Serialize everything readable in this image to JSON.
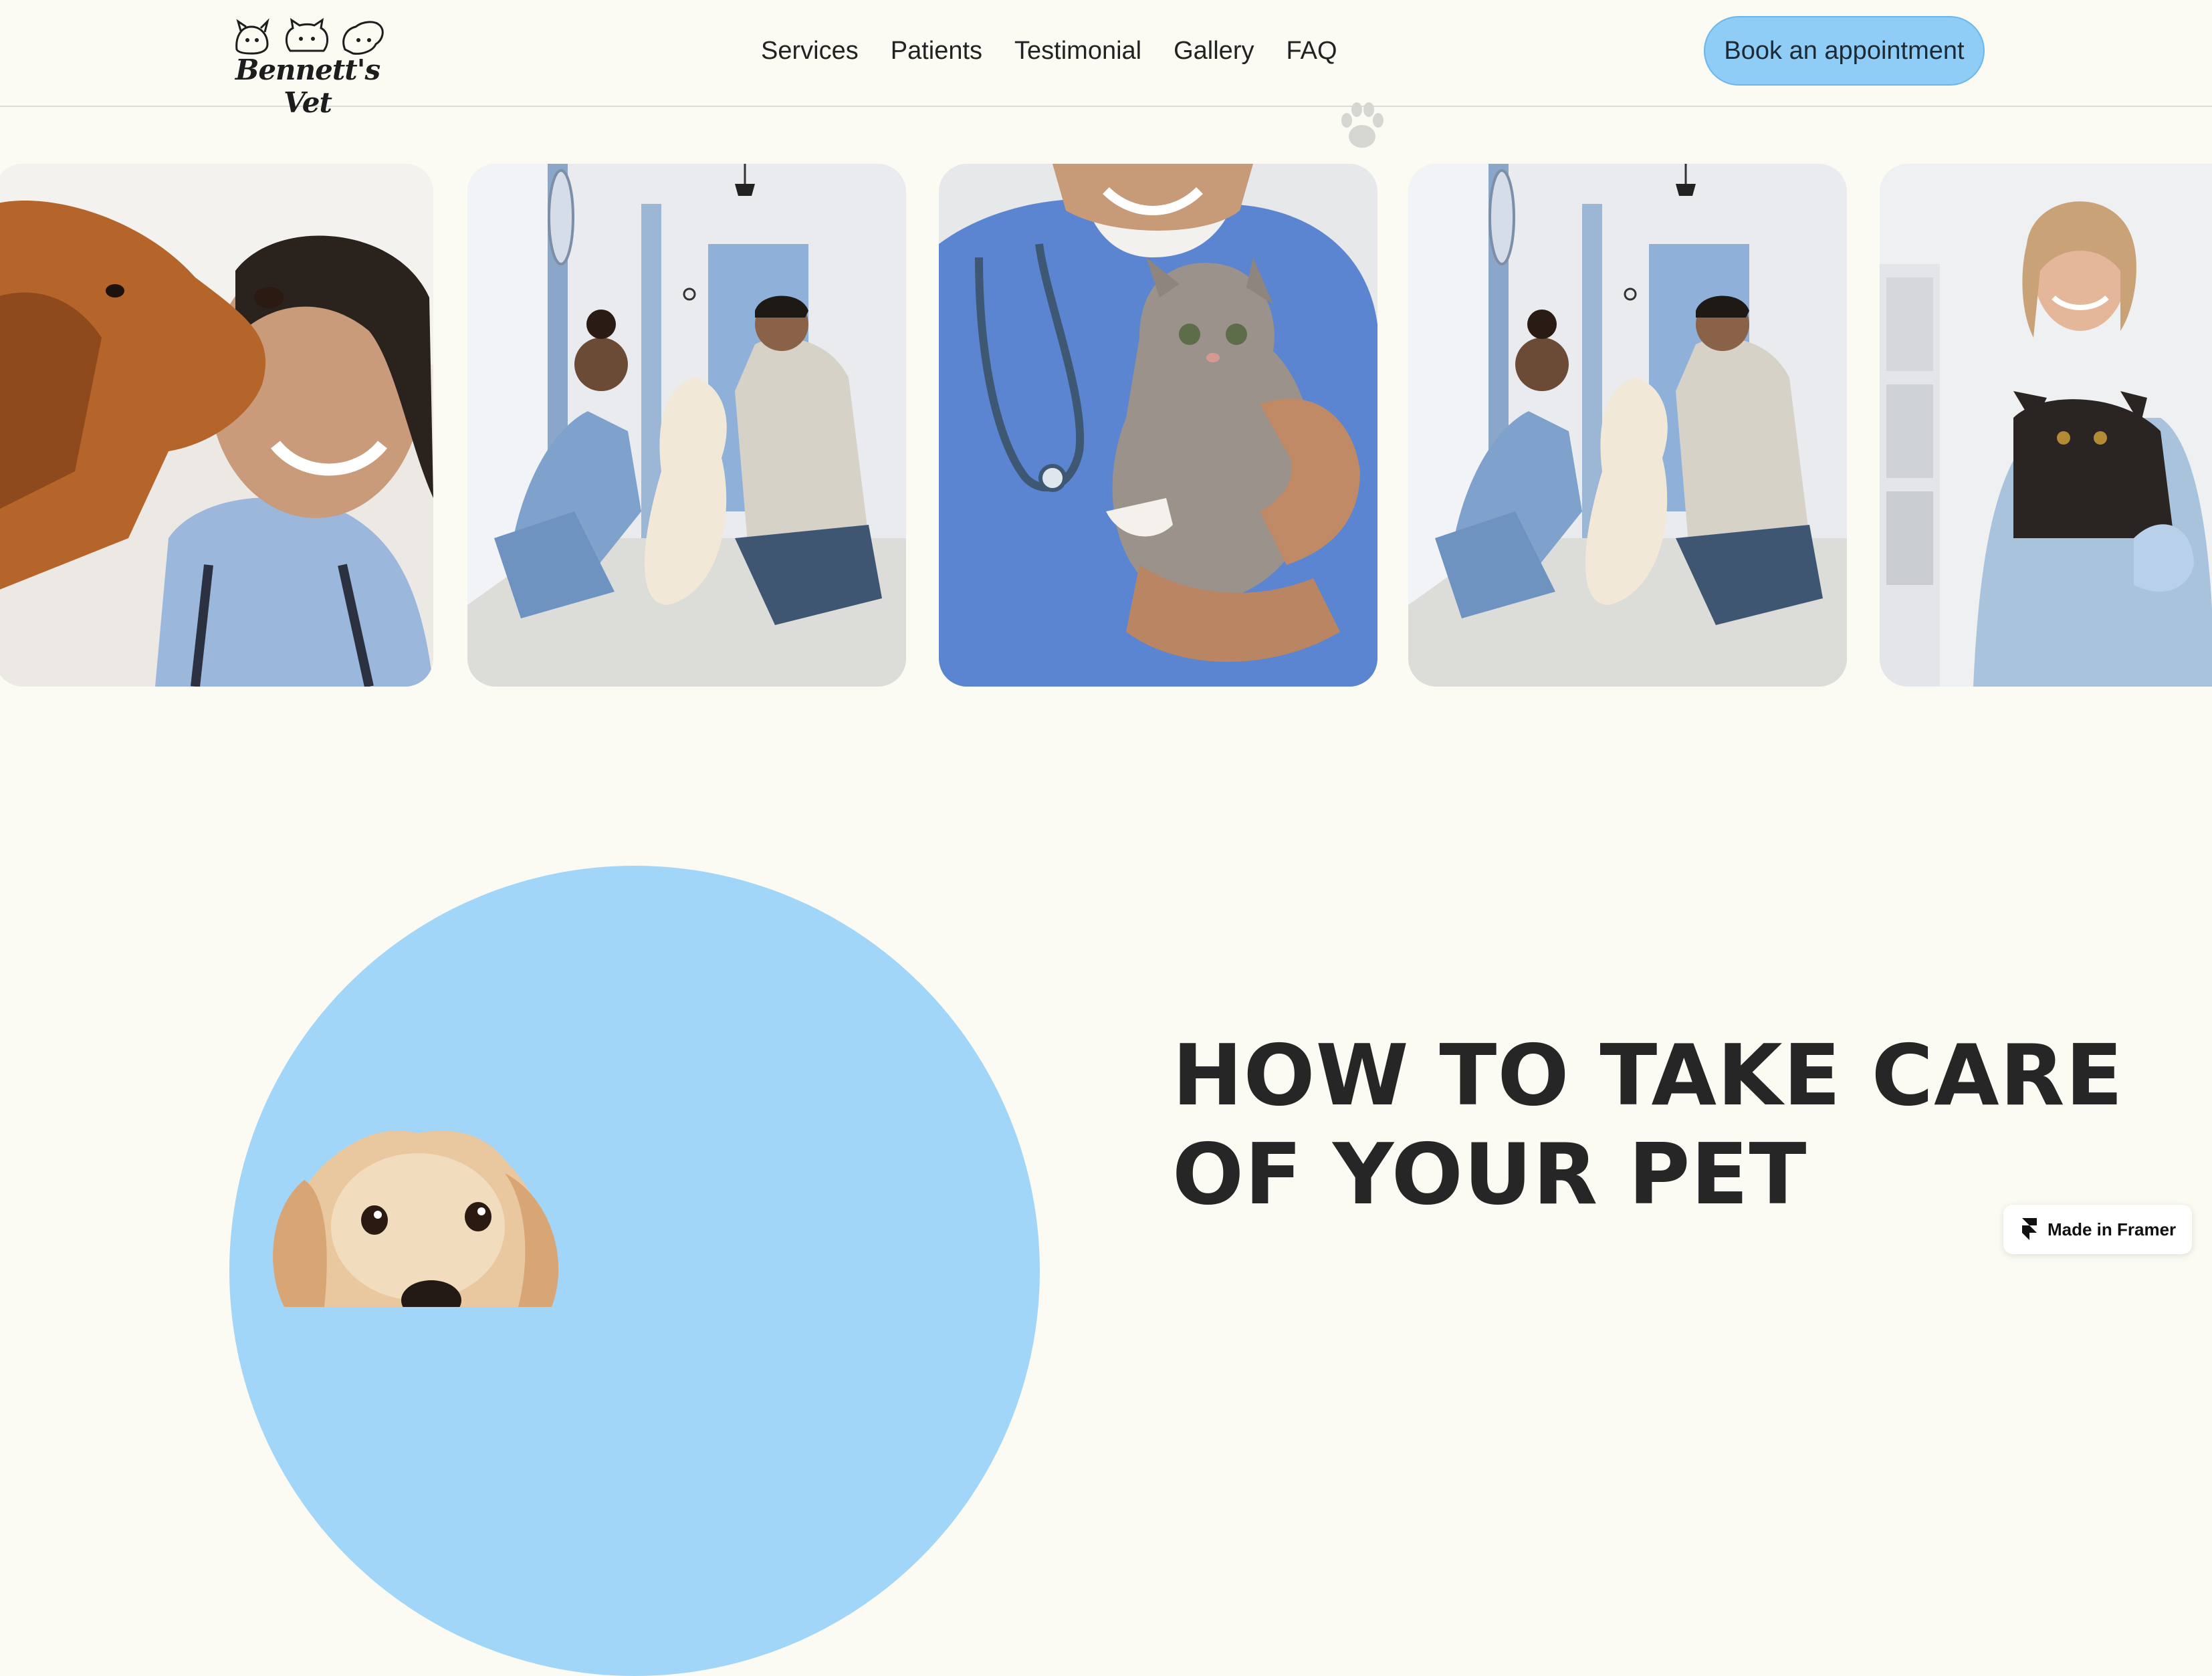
{
  "brand": {
    "name": "Bennett's Vet",
    "accent": "#8fcdf6",
    "circle_color": "#a2d6f8",
    "background": "#fbfbf4"
  },
  "nav": {
    "items": [
      {
        "label": "Services"
      },
      {
        "label": "Patients"
      },
      {
        "label": "Testimonial"
      },
      {
        "label": "Gallery"
      },
      {
        "label": "FAQ"
      }
    ]
  },
  "header": {
    "cta_label": "Book an appointment"
  },
  "gallery": {
    "images": [
      {
        "name": "dog-licking-vet-photo"
      },
      {
        "name": "vets-with-white-dog-photo"
      },
      {
        "name": "vet-holding-kitten-photo"
      },
      {
        "name": "vets-with-white-dog-photo-2"
      },
      {
        "name": "vet-holding-black-cat-photo"
      }
    ]
  },
  "section": {
    "heading_line1": "HOW TO TAKE CARE",
    "heading_line2": "OF YOUR PET"
  },
  "badge": {
    "label": "Made in Framer",
    "icon": "framer-icon"
  }
}
